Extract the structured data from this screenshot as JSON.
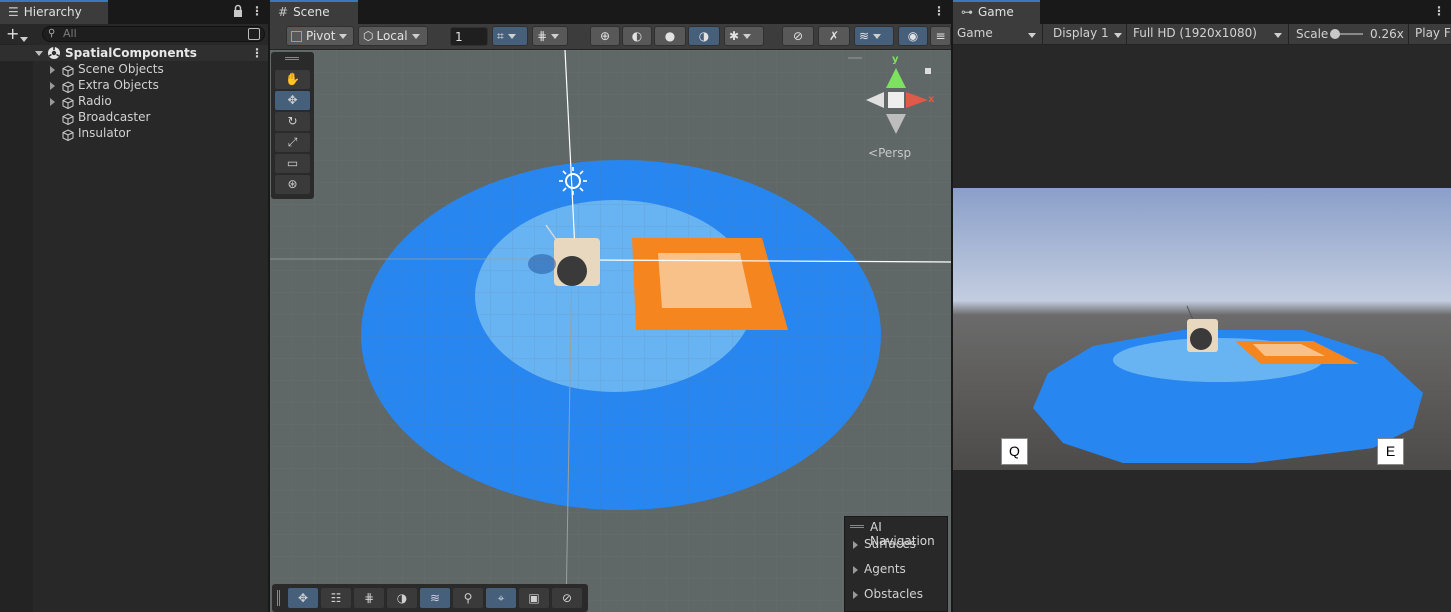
{
  "hierarchy": {
    "tab_label": "Hierarchy",
    "search_placeholder": "All",
    "scene_name": "SpatialComponents",
    "items": [
      {
        "label": "Scene Objects",
        "expandable": true
      },
      {
        "label": "Extra Objects",
        "expandable": true
      },
      {
        "label": "Radio",
        "expandable": true
      },
      {
        "label": "Broadcaster",
        "expandable": false
      },
      {
        "label": "Insulator",
        "expandable": false
      }
    ]
  },
  "scene": {
    "tab_label": "Scene",
    "pivot_label": "Pivot",
    "local_label": "Local",
    "grid_value": "1",
    "persp_label": "Persp",
    "axis_x": "x",
    "axis_y": "y",
    "tools": [
      "hand-tool",
      "move-tool",
      "rotate-tool",
      "scale-tool",
      "rect-tool",
      "transform-tool"
    ],
    "active_tool": "move-tool",
    "ai_nav": {
      "title": "AI Navigation",
      "items": [
        "Surfaces",
        "Agents",
        "Obstacles"
      ]
    }
  },
  "game": {
    "tab_label": "Game",
    "view_label": "Game",
    "display_label": "Display 1",
    "resolution_label": "Full HD (1920x1080)",
    "scale_label": "Scale",
    "scale_value": "0.26x",
    "play_label": "Play Fo",
    "key_left": "Q",
    "key_right": "E"
  },
  "colors": {
    "accent": "#3a79bb",
    "outer_disc": "#2886f0",
    "inner_disc": "#68b3f2",
    "orange_square": "#f5861f",
    "inner_square": "#f9c18a",
    "scene_bg": "#5f6767"
  }
}
